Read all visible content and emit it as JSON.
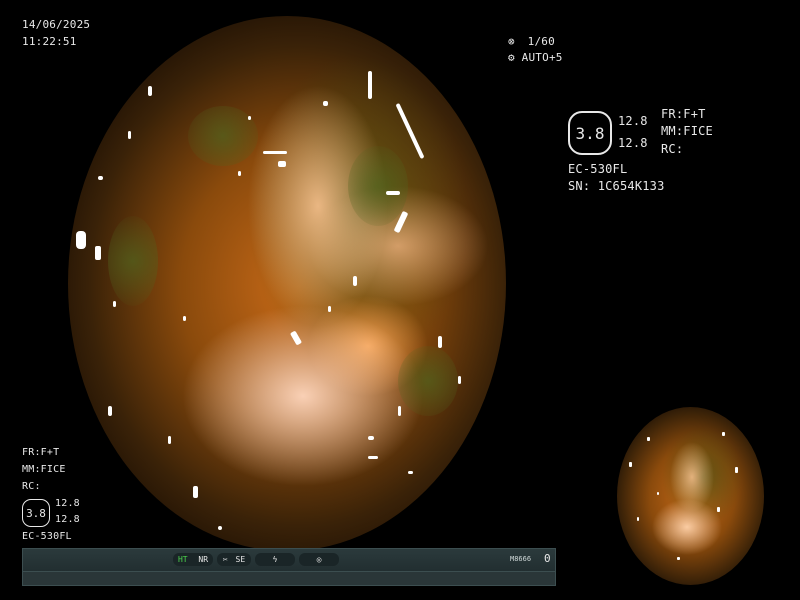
{
  "timestamp": {
    "date": "14/06/2025",
    "time": "11:22:51"
  },
  "exposure": {
    "shutter": "1/60",
    "auto": "AUTO+5",
    "shutter_icon": "shutter-icon",
    "auto_icon": "auto-exposure-icon"
  },
  "right_panel": {
    "badge_value": "3.8",
    "value_top": "12.8",
    "value_bottom": "12.8",
    "fr": "FR:F+T",
    "mm": "MM:FICE",
    "rc": "RC:",
    "scope_model": "EC-530FL",
    "serial": "SN: 1C654K133"
  },
  "left_panel": {
    "fr": "FR:F+T",
    "mm": "MM:FICE",
    "rc": "RC:",
    "badge_value": "3.8",
    "value_top": "12.8",
    "value_bottom": "12.8",
    "scope_model": "EC-530FL"
  },
  "status_bar": {
    "ht": "HT",
    "nr": "NR",
    "se": "SE",
    "code": "M8666",
    "count": "0",
    "ht_color": "#4cd44c",
    "se_icon": "scissors-icon",
    "flash_icon": "flash-icon",
    "camera_icon": "camera-icon"
  },
  "colors": {
    "text": "#e8e8e8",
    "background": "#000000"
  }
}
